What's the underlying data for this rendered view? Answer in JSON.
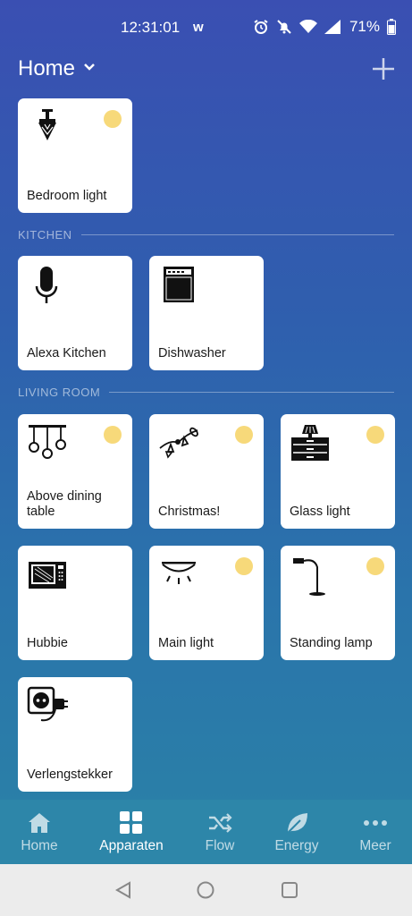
{
  "status": {
    "time": "12:31:01",
    "app_indicator": "w",
    "battery": "71%"
  },
  "header": {
    "title": "Home"
  },
  "sections": {
    "kitchen": "KITCHEN",
    "living_room": "LIVING ROOM"
  },
  "devices": {
    "bedroom_light": "Bedroom light",
    "alexa_kitchen": "Alexa Kitchen",
    "dishwasher": "Dishwasher",
    "above_dining_table": "Above dining table",
    "christmas": "Christmas!",
    "glass_light": "Glass light",
    "hubbie": "Hubbie",
    "main_light": "Main light",
    "standing_lamp": "Standing lamp",
    "verlengstekker": "Verlengstekker"
  },
  "nav": {
    "home": "Home",
    "apparaten": "Apparaten",
    "flow": "Flow",
    "energy": "Energy",
    "meer": "Meer"
  },
  "colors": {
    "sun_indicator": "#f7d97a",
    "nav_background": "#2d86a9"
  },
  "icons": {
    "bedroom_light": "chandelier-icon",
    "alexa_kitchen": "microphone-icon",
    "dishwasher": "dishwasher-icon",
    "above_dining_table": "pendant-lights-icon",
    "christmas": "string-lights-icon",
    "glass_light": "table-lamp-icon",
    "hubbie": "microwave-icon",
    "main_light": "ceiling-light-icon",
    "standing_lamp": "floor-lamp-icon",
    "verlengstekker": "power-socket-icon"
  }
}
